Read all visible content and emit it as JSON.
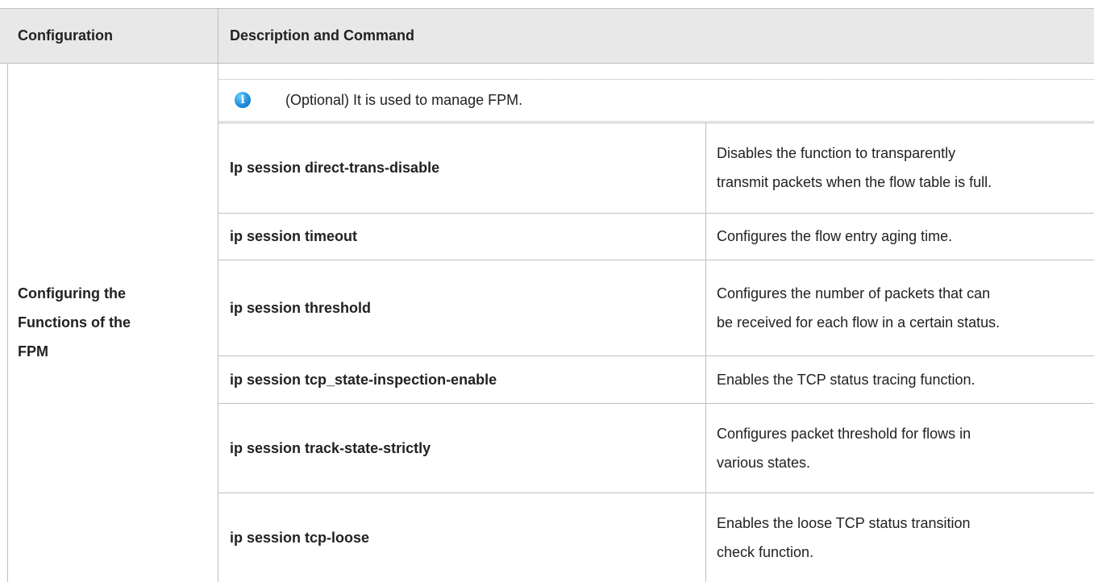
{
  "table": {
    "headers": {
      "col1": "Configuration",
      "col2": "Description and Command"
    },
    "section_label_lines": [
      "Configuring the",
      "Functions of the",
      "FPM"
    ],
    "note": {
      "icon": "info-icon",
      "text": "(Optional) It is used to manage FPM."
    },
    "rows": [
      {
        "command": "Ip session direct-trans-disable",
        "desc_lines": [
          "Disables the function to transparently",
          "transmit packets when the flow table is full."
        ]
      },
      {
        "command": "ip session timeout",
        "desc_lines": [
          "Configures the flow entry aging time."
        ]
      },
      {
        "command": "ip session threshold",
        "desc_lines": [
          "Configures the number of packets that can",
          "be received for each flow in a certain status."
        ]
      },
      {
        "command": "ip session tcp_state-inspection-enable",
        "desc_lines": [
          "Enables the TCP status tracing function."
        ]
      },
      {
        "command": "ip session track-state-strictly",
        "desc_lines": [
          "Configures packet threshold for flows in",
          "various states."
        ]
      },
      {
        "command": "ip session tcp-loose",
        "desc_lines": [
          "Enables the loose TCP status transition",
          "check function."
        ]
      }
    ]
  },
  "colors": {
    "header_bg": "#e8e8e8",
    "border": "#bfbfbf",
    "info_icon": "#1e90e0"
  }
}
